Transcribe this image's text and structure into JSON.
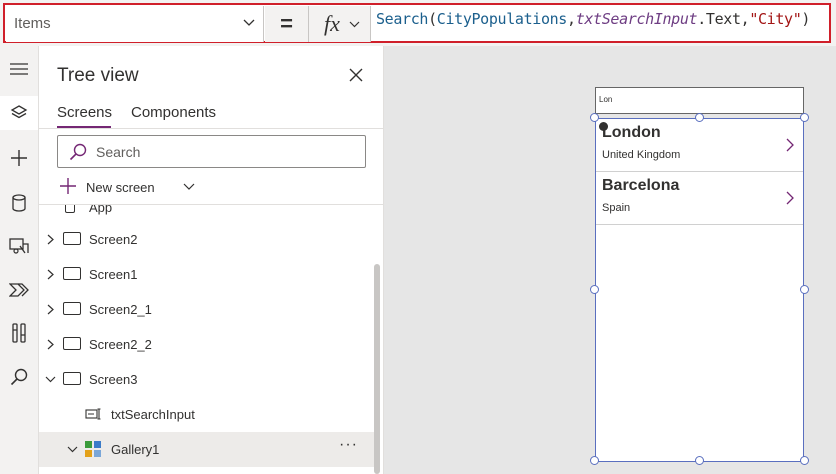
{
  "formula_bar": {
    "property": "Items",
    "equals": "=",
    "fx": "fx",
    "formula": {
      "fn": "Search",
      "open": "(",
      "table": "CityPopulations",
      "comma1": ",",
      "control": "txtSearchInput",
      "prop": ".Text",
      "comma2": ",",
      "str": "\"City\"",
      "close": ")"
    }
  },
  "tree_view": {
    "title": "Tree view",
    "tabs": [
      "Screens",
      "Components"
    ],
    "search_placeholder": "Search",
    "new_screen": "New screen",
    "nodes": [
      {
        "label": "App"
      },
      {
        "label": "Screen2"
      },
      {
        "label": "Screen1"
      },
      {
        "label": "Screen2_1"
      },
      {
        "label": "Screen2_2"
      },
      {
        "label": "Screen3"
      },
      {
        "label": "txtSearchInput"
      },
      {
        "label": "Gallery1"
      }
    ],
    "more": "···"
  },
  "canvas": {
    "search_value": "Lon",
    "items": [
      {
        "title": "London",
        "subtitle": "United Kingdom"
      },
      {
        "title": "Barcelona",
        "subtitle": "Spain"
      }
    ]
  },
  "icons": {
    "rail": [
      "hamburger-icon",
      "layers-icon",
      "plus-icon",
      "database-icon",
      "media-icon",
      "power-automate-icon",
      "tools-icon",
      "search-icon"
    ]
  },
  "colors": {
    "highlight_border": "#d01f2a",
    "accent": "#742774",
    "selection": "#5a6fbf"
  }
}
